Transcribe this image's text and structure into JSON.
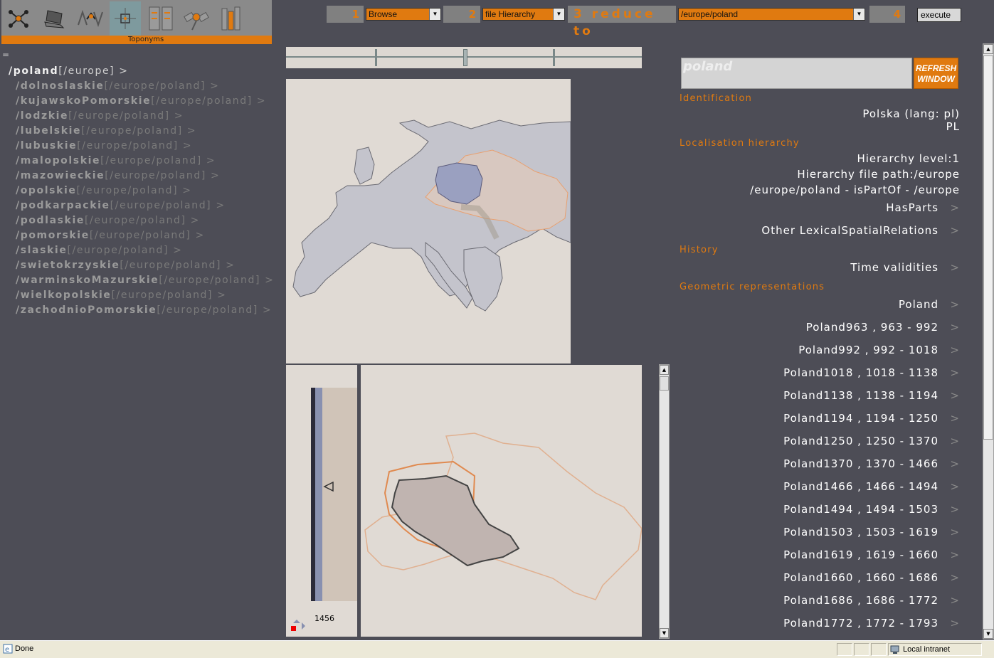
{
  "toolbar": {
    "label": "Toponyms",
    "tools": [
      "network-icon",
      "laptop-icon",
      "signal-icon",
      "locate-icon",
      "documents-icon",
      "satellite-icon",
      "books-icon"
    ]
  },
  "steps": {
    "n1": "1",
    "s1": "Browse",
    "n2": "2",
    "s2": "file Hierarchy",
    "n3": "3",
    "reduce_label": "reduce to",
    "s3": "/europe/poland",
    "n4": "4",
    "execute": "execute"
  },
  "tree": {
    "eq": "=",
    "root": {
      "name": "/poland",
      "path": "[/europe]",
      "chev": ">"
    },
    "items": [
      {
        "name": "/dolnoslaskie",
        "path": "[/europe/poland]",
        "chev": ">"
      },
      {
        "name": "/kujawskoPomorskie",
        "path": "[/europe/poland]",
        "chev": ">"
      },
      {
        "name": "/lodzkie",
        "path": "[/europe/poland]",
        "chev": ">"
      },
      {
        "name": "/lubelskie",
        "path": "[/europe/poland]",
        "chev": ">"
      },
      {
        "name": "/lubuskie",
        "path": "[/europe/poland]",
        "chev": ">"
      },
      {
        "name": "/malopolskie",
        "path": "[/europe/poland]",
        "chev": ">"
      },
      {
        "name": "/mazowieckie",
        "path": "[/europe/poland]",
        "chev": ">"
      },
      {
        "name": "/opolskie",
        "path": "[/europe/poland]",
        "chev": ">"
      },
      {
        "name": "/podkarpackie",
        "path": "[/europe/poland]",
        "chev": ">"
      },
      {
        "name": "/podlaskie",
        "path": "[/europe/poland]",
        "chev": ">"
      },
      {
        "name": "/pomorskie",
        "path": "[/europe/poland]",
        "chev": ">"
      },
      {
        "name": "/slaskie",
        "path": "[/europe/poland]",
        "chev": ">"
      },
      {
        "name": "/swietokrzyskie",
        "path": "[/europe/poland]",
        "chev": ">"
      },
      {
        "name": "/warminskoMazurskie",
        "path": "[/europe/poland]",
        "chev": ">"
      },
      {
        "name": "/wielkopolskie",
        "path": "[/europe/poland]",
        "chev": ">"
      },
      {
        "name": "/zachodnioPomorskie",
        "path": "[/europe/poland]",
        "chev": ">"
      }
    ]
  },
  "timeline": {
    "year": "1456"
  },
  "info": {
    "search_value": "poland",
    "refresh_line1": "REFRESH",
    "refresh_line2": "WINDOW",
    "identification": {
      "heading": "Identification",
      "name": "Polska (lang: pl)",
      "code": "PL"
    },
    "localisation": {
      "heading": "Localisation hierarchy",
      "level": "Hierarchy level:1",
      "file_path": "Hierarchy file path:/europe",
      "relation": "/europe/poland - isPartOf - /europe",
      "has_parts": "HasParts",
      "other": "Other LexicalSpatialRelations"
    },
    "history": {
      "heading": "History",
      "time": "Time validities"
    },
    "geometry": {
      "heading": "Geometric representations",
      "items": [
        "Poland",
        "Poland963 , 963 - 992",
        "Poland992 , 992 - 1018",
        "Poland1018 , 1018 - 1138",
        "Poland1138 , 1138 - 1194",
        "Poland1194 , 1194 - 1250",
        "Poland1250 , 1250 - 1370",
        "Poland1370 , 1370 - 1466",
        "Poland1466 , 1466 - 1494",
        "Poland1494 , 1494 - 1503",
        "Poland1503 , 1503 - 1619",
        "Poland1619 , 1619 - 1660",
        "Poland1660 , 1660 - 1686",
        "Poland1686 , 1686 - 1772",
        "Poland1772 , 1772 - 1793"
      ]
    },
    "chev": ">"
  },
  "status": {
    "text": "Done",
    "zone": "Local intranet"
  },
  "colors": {
    "accent": "#e07a10",
    "background": "#4d4d56",
    "map_bg": "#e0dad4",
    "land": "#c4c4cc",
    "border_orange": "#e8a070"
  }
}
